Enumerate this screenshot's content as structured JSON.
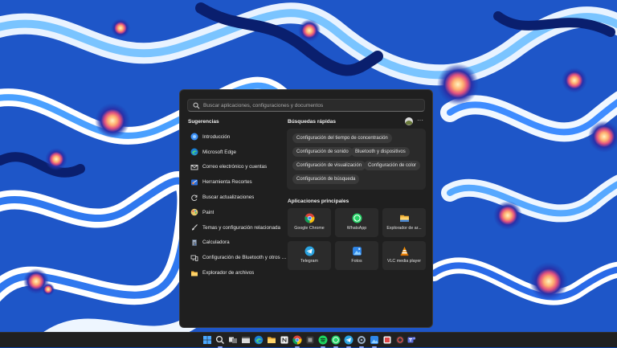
{
  "search": {
    "placeholder": "Buscar aplicaciones, configuraciones y documentos",
    "value": ""
  },
  "suggestions": {
    "title": "Sugerencias",
    "items": [
      {
        "label": "Introducción",
        "icon": "introduction-icon"
      },
      {
        "label": "Microsoft Edge",
        "icon": "edge-icon"
      },
      {
        "label": "Correo electrónico y cuentas",
        "icon": "mail-icon"
      },
      {
        "label": "Herramienta Recortes",
        "icon": "snipping-tool-icon"
      },
      {
        "label": "Buscar actualizaciones",
        "icon": "refresh-icon"
      },
      {
        "label": "Paint",
        "icon": "paint-icon"
      },
      {
        "label": "Temas y configuración relacionada",
        "icon": "brush-icon"
      },
      {
        "label": "Calculadora",
        "icon": "calculator-icon"
      },
      {
        "label": "Configuración de Bluetooth y otros dis...",
        "icon": "bluetooth-devices-icon"
      },
      {
        "label": "Explorador de archivos",
        "icon": "folder-icon"
      }
    ]
  },
  "quick_searches": {
    "title": "Búsquedas rápidas",
    "chips": [
      "Configuración del tiempo de concentración",
      "Configuración de sonido",
      "Bluetooth y dispositivos",
      "Configuración de visualización",
      "Configuración de color",
      "Configuración de búsqueda"
    ]
  },
  "top_apps": {
    "title": "Aplicaciones principales",
    "apps": [
      {
        "label": "Google Chrome",
        "icon": "chrome-icon"
      },
      {
        "label": "WhatsApp",
        "icon": "whatsapp-icon"
      },
      {
        "label": "Explorador de ar...",
        "icon": "folder-icon"
      },
      {
        "label": "Telegram",
        "icon": "telegram-icon"
      },
      {
        "label": "Fotos",
        "icon": "photos-icon"
      },
      {
        "label": "VLC media player",
        "icon": "vlc-icon"
      }
    ]
  },
  "header_actions": {
    "more_label": "···"
  },
  "taskbar": {
    "icons": [
      "windows-start-icon",
      "search-icon",
      "task-view-icon",
      "file-explorer-icon",
      "edge-icon",
      "folder-icon",
      "notion-icon",
      "chrome-icon",
      "spotify-icon",
      "whatsapp-icon",
      "telegram-icon",
      "settings-icon",
      "photos-icon",
      "office-icon",
      "app-icon",
      "teams-icon"
    ]
  },
  "colors": {
    "panel_bg": "#1f1f1f",
    "tile_bg": "#2b2b2b",
    "accent": "#4a8cff"
  }
}
